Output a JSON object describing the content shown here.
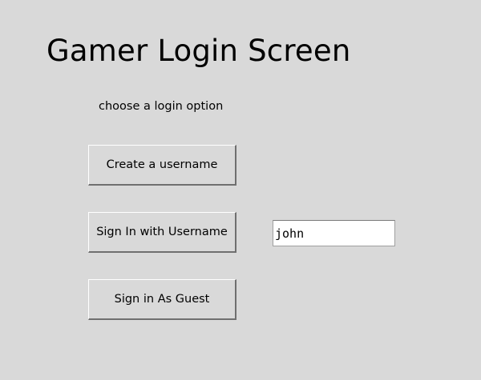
{
  "window": {
    "title": "Gamer Login Screen",
    "subtitle": "choose a login option",
    "background_color": "#d9d9d9"
  },
  "buttons": {
    "create_label": "Create a username",
    "signin_label": "Sign In with Username",
    "guest_label": "Sign in As Guest"
  },
  "username_input": {
    "value": "john",
    "placeholder": ""
  }
}
